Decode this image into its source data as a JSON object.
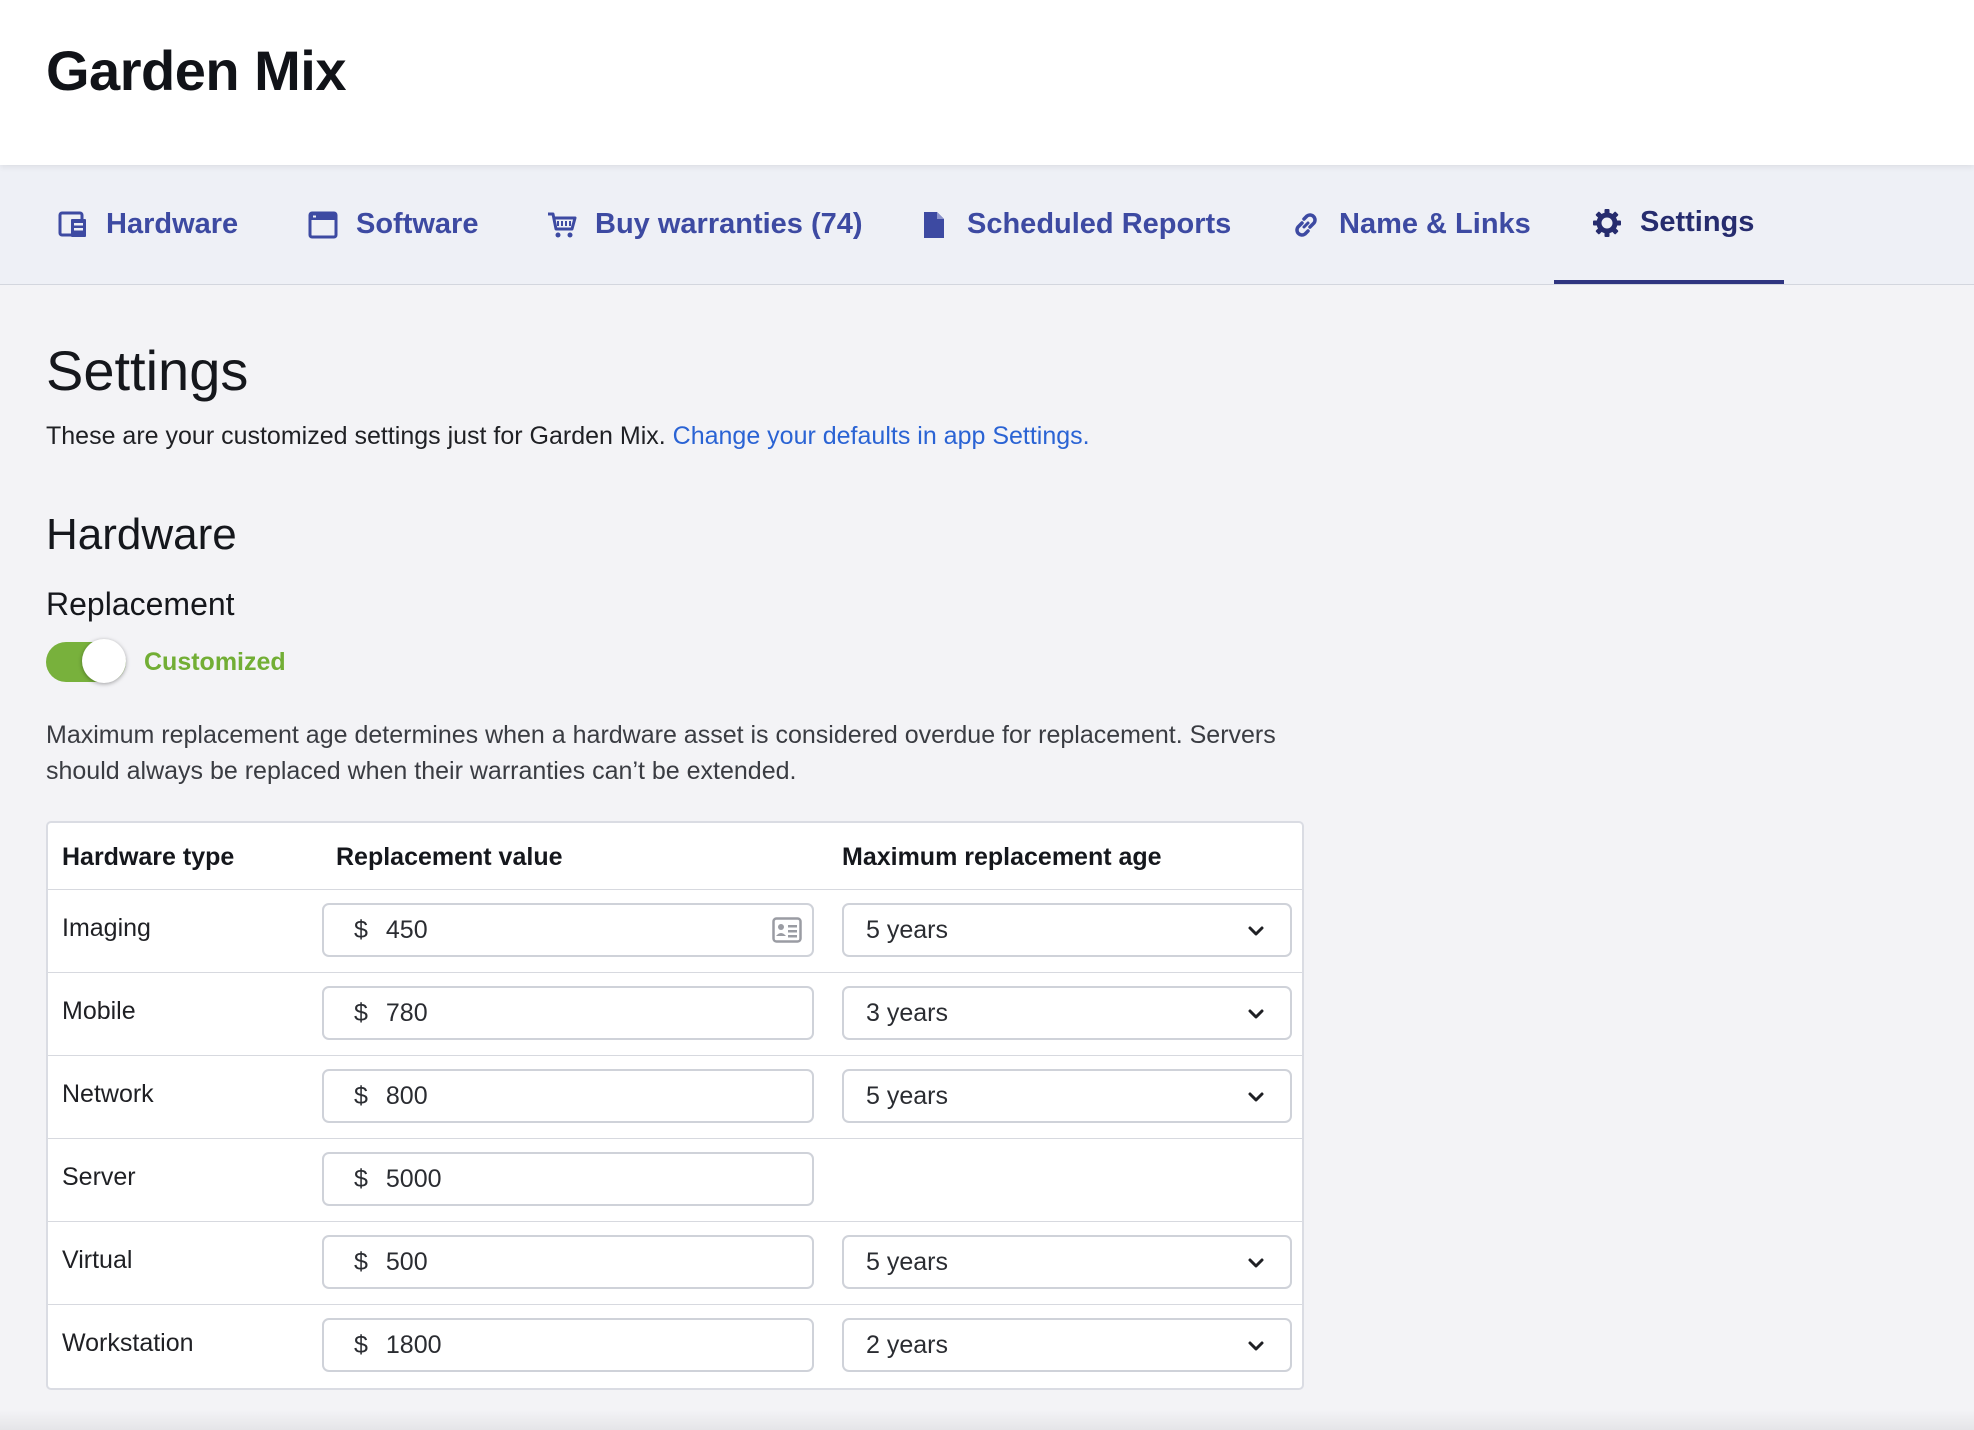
{
  "header": {
    "app_title": "Garden Mix"
  },
  "tabs": [
    {
      "label": "Hardware",
      "icon": "hardware-icon"
    },
    {
      "label": "Software",
      "icon": "software-window-icon"
    },
    {
      "label": "Buy warranties (74)",
      "icon": "cart-icon"
    },
    {
      "label": "Scheduled Reports",
      "icon": "document-icon"
    },
    {
      "label": "Name & Links",
      "icon": "link-icon"
    },
    {
      "label": "Settings",
      "icon": "gear-icon",
      "active": true
    }
  ],
  "page": {
    "heading": "Settings",
    "intro_text": "These are your customized settings just for Garden Mix.",
    "intro_link": "Change your defaults in app Settings."
  },
  "hardware": {
    "heading": "Hardware",
    "replacement": {
      "heading": "Replacement",
      "toggle_on": true,
      "toggle_label": "Customized",
      "description": "Maximum replacement age determines when a hardware asset is considered overdue for replacement. Servers should always be replaced when their warranties can’t be extended."
    },
    "table": {
      "headers": [
        "Hardware type",
        "Replacement value",
        "Maximum replacement age"
      ],
      "currency_symbol": "$",
      "rows": [
        {
          "type": "Imaging",
          "value": "450",
          "age": "5 years"
        },
        {
          "type": "Mobile",
          "value": "780",
          "age": "3 years"
        },
        {
          "type": "Network",
          "value": "800",
          "age": "5 years"
        },
        {
          "type": "Server",
          "value": "5000",
          "age": null
        },
        {
          "type": "Virtual",
          "value": "500",
          "age": "5 years"
        },
        {
          "type": "Workstation",
          "value": "1800",
          "age": "2 years"
        }
      ]
    }
  },
  "colors": {
    "tab_text": "#3d4aa2",
    "tab_active": "#262c6e",
    "link": "#2a63d4",
    "toggle_on": "#78b13c",
    "customized_label": "#72ae35"
  }
}
